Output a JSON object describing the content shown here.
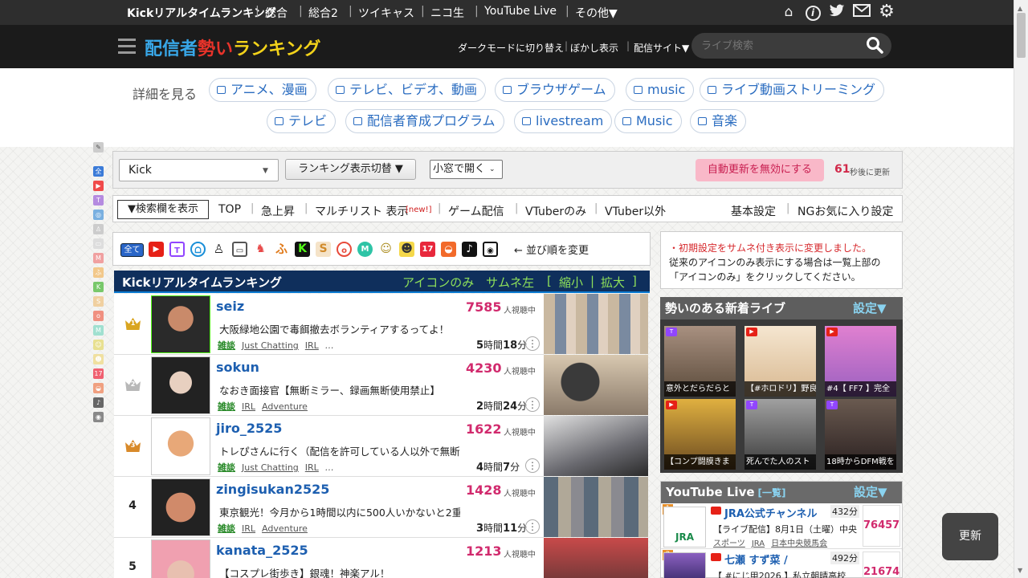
{
  "topnav": {
    "items": [
      "Kickリアルタイムランキング",
      "総合",
      "総合2",
      "ツイキャス",
      "ニコ生",
      "YouTube Live",
      "その他▼"
    ],
    "icons": [
      "home-icon",
      "info-icon",
      "twitter-icon",
      "mail-icon",
      "gear-icon"
    ]
  },
  "header": {
    "logo_part1": "配信者",
    "logo_part2": "勢い",
    "logo_part3": "ランキング",
    "darkmode": "ダークモードに切り替え",
    "blur": "ぼかし表示",
    "sites": "配信サイト▼",
    "search_placeholder": "ライブ検索"
  },
  "categories": {
    "label": "詳細を見る",
    "row1": [
      "アニメ、漫画",
      "テレビ、ビデオ、動画",
      "ブラウザゲーム",
      "music",
      "ライブ動画ストリーミング"
    ],
    "row2": [
      "テレビ",
      "配信者育成プログラム",
      "livestream",
      "Music",
      "音楽"
    ]
  },
  "controls": {
    "site_select": "Kick",
    "view_toggle": "ランキング表示切替 ▼",
    "open_mode": "小窓で開く",
    "auto_update": "自動更新を無効にする",
    "countdown": "61",
    "countdown_suffix": "秒後に更新"
  },
  "tabs": {
    "search_toggle": "▼検索欄を表示",
    "items": [
      "TOP",
      "急上昇",
      "マルチリスト 表示",
      "ゲーム配信",
      "VTuberのみ",
      "VTuber以外"
    ],
    "new_badge": "[new!]",
    "settings": "基本設定",
    "ng": "NGお気に入り設定"
  },
  "filter": {
    "all_label": "全て",
    "sort_hint": "← 並び順を変更",
    "icon_labels": [
      "YT",
      "Tw",
      "Ws",
      "Ck",
      "Tv",
      "Ml",
      "ふ",
      "K",
      "S",
      "o",
      "M",
      "Pk",
      "Nb",
      "17",
      "Sh",
      "Tk",
      "Os"
    ]
  },
  "ranking": {
    "title": "Kickリアルタイムランキング",
    "icon_only": "アイコンのみ",
    "thumb_left": "サムネ左",
    "shrink": "縮小",
    "enlarge": "拡大",
    "viewers_label": "人視聴中",
    "rows": [
      {
        "rank": "1",
        "name": "seiz",
        "viewers": "7585",
        "title": "大阪緑地公園で毒餌撤去ボランティアするってよ！",
        "tag1": "雑談",
        "tag2": "Just Chatting",
        "tag3": "IRL",
        "more": "…",
        "hours": "5",
        "h": "時間",
        "minutes": "18",
        "m": "分"
      },
      {
        "rank": "2",
        "name": "sokun",
        "viewers": "4230",
        "title": "なおき面接官【無断ミラー、録画無断使用禁止】",
        "tag1": "雑談",
        "tag2": "IRL",
        "tag3": "Adventure",
        "more": "",
        "hours": "2",
        "h": "時間",
        "minutes": "24",
        "m": "分"
      },
      {
        "rank": "3",
        "name": "jiro_2525",
        "viewers": "1622",
        "title": "トレぴさんに行く（配信を許可している人以外で無断ミラー",
        "tag1": "雑談",
        "tag2": "Just Chatting",
        "tag3": "IRL",
        "more": "…",
        "hours": "4",
        "h": "時間",
        "minutes": "7",
        "m": "分"
      },
      {
        "rank": "4",
        "name": "zingisukan2525",
        "viewers": "1428",
        "title": "東京観光！今月から1時間以内に500人いかないと2重降",
        "tag1": "雑談",
        "tag2": "IRL",
        "tag3": "Adventure",
        "more": "",
        "hours": "3",
        "h": "時間",
        "minutes": "11",
        "m": "分"
      },
      {
        "rank": "5",
        "name": "kanata_2525",
        "viewers": "1213",
        "title": "【コスプレ街歩き】銀魂！神楽アル！",
        "tag1": "",
        "tag2": "",
        "tag3": "",
        "more": "",
        "hours": "",
        "h": "",
        "minutes": "",
        "m": ""
      }
    ]
  },
  "notice": {
    "line1": "・初期設定をサムネ付き表示に変更しました。",
    "line2": "従来のアイコンのみ表示にする場合は一覧上部の",
    "line3": "「アイコンのみ」をクリックしてください。"
  },
  "new_live": {
    "title": "勢いのある新着ライブ",
    "settings": "設定▼",
    "items": [
      {
        "caption": "意外とだらだらと"
      },
      {
        "caption": "【#ホロドリ】野良"
      },
      {
        "caption": "#4【 FF7 】完全"
      },
      {
        "caption": "【コンプ闘膜きま"
      },
      {
        "caption": "死んでた人のスト"
      },
      {
        "caption": "18時からDFM戦を"
      }
    ]
  },
  "youtube": {
    "title": "YouTube Live",
    "list_link": "[一覧]",
    "settings": "設定▼",
    "items": [
      {
        "rank": "1",
        "channel": "JRA公式チャンネル",
        "duration": "432分",
        "title": "【ライブ配信】8月1日（土曜）中央",
        "tags": [
          "スポーツ",
          "JRA",
          "日本中央競馬会"
        ],
        "viewers": "76457",
        "logo": "JRA"
      },
      {
        "rank": "2",
        "channel": "七瀬 すず菜 /",
        "duration": "492分",
        "title": "【 #にじ甲2026 】私立朝晴高校",
        "tags": [],
        "viewers": "21674",
        "logo": ""
      }
    ]
  },
  "update_button": "更新",
  "colors": {
    "accent_blue": "#1d5fb0",
    "viewer_pink": "#d12a6d",
    "auto_btn": "#f9b8c8",
    "gold": "#d9a520",
    "silver": "#b8b8b8",
    "bronze": "#d88a2a"
  }
}
